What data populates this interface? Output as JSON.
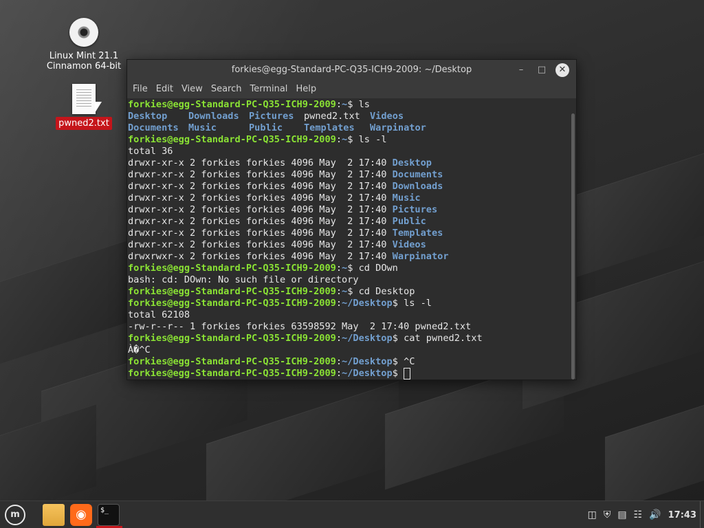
{
  "desktop": {
    "icons": [
      {
        "label_line1": "Linux Mint 21.1",
        "label_line2": "Cinnamon 64-bit"
      },
      {
        "label": "pwned2.txt"
      }
    ]
  },
  "window": {
    "title": "forkies@egg-Standard-PC-Q35-ICH9-2009: ~/Desktop",
    "minimize_icon": "–",
    "maximize_icon": "□",
    "close_icon": "✕",
    "menu": [
      "File",
      "Edit",
      "View",
      "Search",
      "Terminal",
      "Help"
    ]
  },
  "terminal": {
    "prompt": "forkies@egg-Standard-PC-Q35-ICH9-2009",
    "sep": ":",
    "home": "~",
    "desk": "~/Desktop",
    "dollar": "$ ",
    "cmds": {
      "ls": "ls",
      "lsl": "ls -l",
      "cddown": "cd DOwn",
      "cddesk": "cd Desktop",
      "cat": "cat pwned2.txt",
      "ctrlc": "^C"
    },
    "ls_row1": [
      "Desktop",
      "Downloads",
      "Pictures",
      "pwned2.txt",
      "Videos"
    ],
    "ls_row2": [
      "Documents",
      "Music",
      "Public",
      "Templates",
      "Warpinator"
    ],
    "total1": "total 36",
    "dirlist": [
      {
        "perm": "drwxr-xr-x 2 forkies forkies 4096 May  2 17:40 ",
        "name": "Desktop"
      },
      {
        "perm": "drwxr-xr-x 2 forkies forkies 4096 May  2 17:40 ",
        "name": "Documents"
      },
      {
        "perm": "drwxr-xr-x 2 forkies forkies 4096 May  2 17:40 ",
        "name": "Downloads"
      },
      {
        "perm": "drwxr-xr-x 2 forkies forkies 4096 May  2 17:40 ",
        "name": "Music"
      },
      {
        "perm": "drwxr-xr-x 2 forkies forkies 4096 May  2 17:40 ",
        "name": "Pictures"
      },
      {
        "perm": "drwxr-xr-x 2 forkies forkies 4096 May  2 17:40 ",
        "name": "Public"
      },
      {
        "perm": "drwxr-xr-x 2 forkies forkies 4096 May  2 17:40 ",
        "name": "Templates"
      },
      {
        "perm": "drwxr-xr-x 2 forkies forkies 4096 May  2 17:40 ",
        "name": "Videos"
      },
      {
        "perm": "drwxrwxr-x 2 forkies forkies 4096 May  2 17:40 ",
        "name": "Warpinator"
      }
    ],
    "err": "bash: cd: DOwn: No such file or directory",
    "total2": "total 62108",
    "filelist": "-rw-r--r-- 1 forkies forkies 63598592 May  2 17:40 pwned2.txt",
    "garbage": "À�^C"
  },
  "taskbar": {
    "menu_icon": "menu-icon",
    "clock": "17:43",
    "tray_icons": [
      "clipboard-icon",
      "shield-icon",
      "notes-icon",
      "network-icon",
      "volume-icon"
    ]
  },
  "colors": {
    "prompt_user": "#8ae234",
    "path": "#729fcf",
    "accent": "#c5151b"
  }
}
